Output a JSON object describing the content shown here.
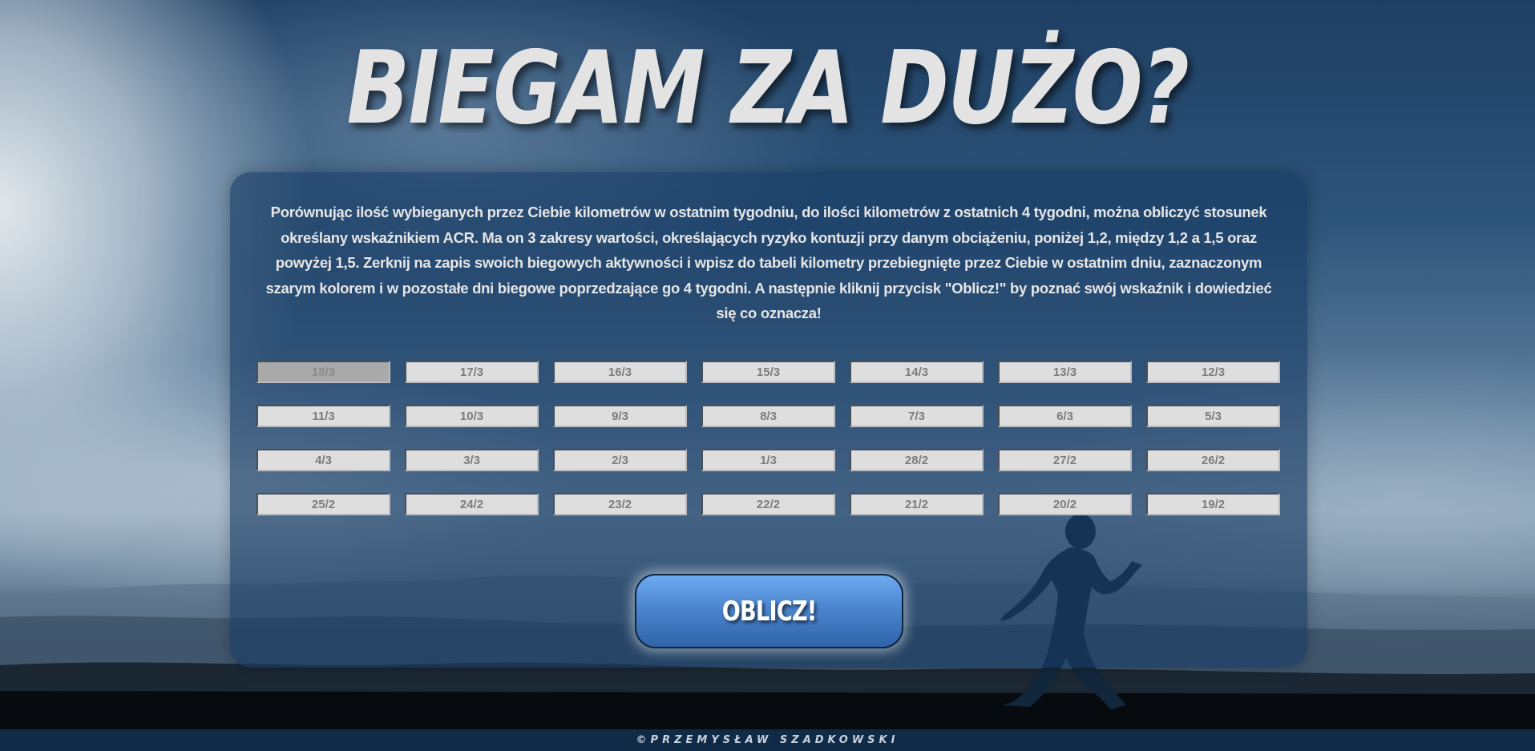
{
  "header": {
    "title": "BIEGAM ZA DUŻO?"
  },
  "intro": {
    "text": "Porównując ilość wybieganych przez Ciebie kilometrów w ostatnim tygodniu, do ilości kilometrów z ostatnich 4 tygodni, można obliczyć stosunek określany wskaźnikiem ACR. Ma on 3 zakresy wartości, określających ryzyko kontuzji przy danym obciążeniu, poniżej 1,2, między 1,2 a 1,5 oraz powyżej 1,5. Zerknij na zapis swoich biegowych aktywności i wpisz do tabeli kilometry przebiegnięte przez Ciebie w ostatnim dniu, zaznaczonym szarym kolorem i w pozostałe dni biegowe poprzedzające go 4 tygodni. A następnie kliknij przycisk \"Oblicz!\" by poznać swój wskaźnik i dowiedzieć się co oznacza!"
  },
  "days": [
    {
      "placeholder": "18/3",
      "value": ""
    },
    {
      "placeholder": "17/3",
      "value": ""
    },
    {
      "placeholder": "16/3",
      "value": ""
    },
    {
      "placeholder": "15/3",
      "value": ""
    },
    {
      "placeholder": "14/3",
      "value": ""
    },
    {
      "placeholder": "13/3",
      "value": ""
    },
    {
      "placeholder": "12/3",
      "value": ""
    },
    {
      "placeholder": "11/3",
      "value": ""
    },
    {
      "placeholder": "10/3",
      "value": ""
    },
    {
      "placeholder": "9/3",
      "value": ""
    },
    {
      "placeholder": "8/3",
      "value": ""
    },
    {
      "placeholder": "7/3",
      "value": ""
    },
    {
      "placeholder": "6/3",
      "value": ""
    },
    {
      "placeholder": "5/3",
      "value": ""
    },
    {
      "placeholder": "4/3",
      "value": ""
    },
    {
      "placeholder": "3/3",
      "value": ""
    },
    {
      "placeholder": "2/3",
      "value": ""
    },
    {
      "placeholder": "1/3",
      "value": ""
    },
    {
      "placeholder": "28/2",
      "value": ""
    },
    {
      "placeholder": "27/2",
      "value": ""
    },
    {
      "placeholder": "26/2",
      "value": ""
    },
    {
      "placeholder": "25/2",
      "value": ""
    },
    {
      "placeholder": "24/2",
      "value": ""
    },
    {
      "placeholder": "23/2",
      "value": ""
    },
    {
      "placeholder": "22/2",
      "value": ""
    },
    {
      "placeholder": "21/2",
      "value": ""
    },
    {
      "placeholder": "20/2",
      "value": ""
    },
    {
      "placeholder": "19/2",
      "value": ""
    }
  ],
  "actions": {
    "calculate_label": "OBLICZ!"
  },
  "footer": {
    "credit": "©PRZEMYSŁAW SZADKOWSKI"
  },
  "colors": {
    "card": "#193c64",
    "button": "#4c86cf",
    "input": "#dedede",
    "today_input": "#a9a9a9",
    "footer": "#0f2b48"
  }
}
